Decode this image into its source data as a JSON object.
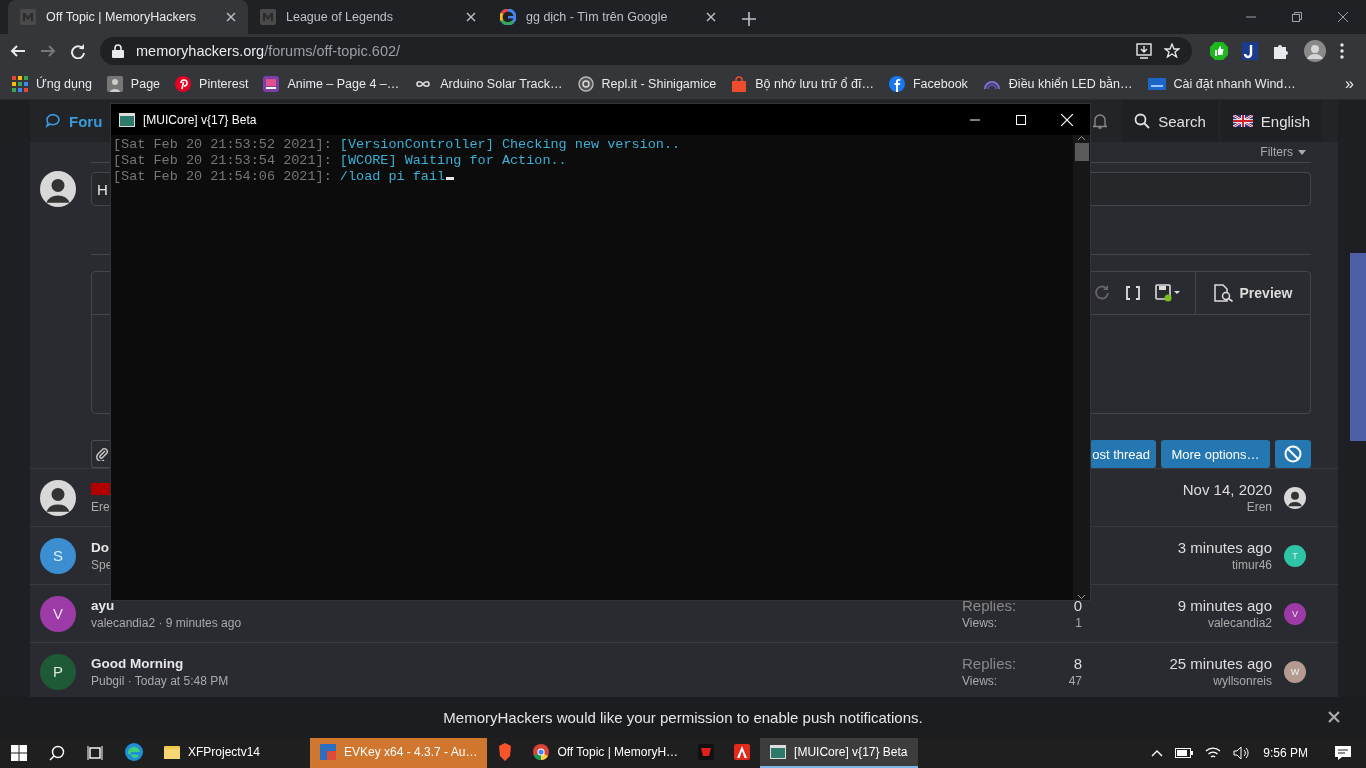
{
  "browser": {
    "tabs": [
      {
        "title": "Off Topic | MemoryHackers",
        "kind": "site",
        "selected": true
      },
      {
        "title": "League of Legends",
        "kind": "site",
        "selected": false
      },
      {
        "title": "gg dịch - Tìm trên Google",
        "kind": "google",
        "selected": false
      }
    ],
    "address": {
      "host": "memoryhackers.org",
      "path": "/forums/off-topic.602/"
    },
    "bookmarks": [
      {
        "label": "Ứng dụng",
        "kind": "apps"
      },
      {
        "label": "Page",
        "kind": "photo"
      },
      {
        "label": "Pinterest",
        "kind": "pinterest"
      },
      {
        "label": "Anime – Page 4 –…",
        "kind": "anime"
      },
      {
        "label": "Arduino Solar Track…",
        "kind": "infinity"
      },
      {
        "label": "Repl.it - Shinigamice",
        "kind": "swirl"
      },
      {
        "label": "Bộ nhớ lưu trữ ổ đĩ…",
        "kind": "bag"
      },
      {
        "label": "Facebook",
        "kind": "facebook"
      },
      {
        "label": "Điều khiển LED bằn…",
        "kind": "dome"
      },
      {
        "label": "Cài đặt nhanh Wind…",
        "kind": "vn"
      }
    ],
    "bookmarks_more": "»"
  },
  "forum": {
    "nav": {
      "title": "Foru",
      "search": "Search",
      "language": "English"
    },
    "filters": "Filters",
    "new_thread": {
      "value": "H"
    },
    "editor": {
      "preview": "Preview"
    },
    "buttons": {
      "post": "ost thread",
      "more": "More options…"
    },
    "threads": [
      {
        "prefix_tag": true,
        "meta": "Ere",
        "date": "Nov 14, 2020",
        "last_user": "Eren"
      },
      {
        "avatar": {
          "kind": "letter",
          "letter": "S",
          "color": "#3b8ed0"
        },
        "prefix_tag": false,
        "title": "Do",
        "meta": "Spe",
        "date": "3 minutes ago",
        "last_user": "timur46",
        "last_avatar": {
          "kind": "letter",
          "letter": "T",
          "color": "#2fc4a6"
        }
      },
      {
        "avatar": {
          "kind": "letter",
          "letter": "V",
          "color": "#9c3aa6"
        },
        "prefix_tag": false,
        "title": "ayu",
        "meta": "valecandia2 · 9 minutes ago",
        "replies_label": "Replies:",
        "replies": "0",
        "views_label": "Views:",
        "views": "1",
        "date": "9 minutes ago",
        "last_user": "valecandia2",
        "last_avatar": {
          "kind": "letter",
          "letter": "V",
          "color": "#9c3aa6"
        }
      },
      {
        "avatar": {
          "kind": "letter",
          "letter": "P",
          "color": "#1d5a35"
        },
        "prefix_tag": false,
        "title": "Good Morning",
        "meta": "Pubgil · Today at 5:48 PM",
        "replies_label": "Replies:",
        "replies": "8",
        "views_label": "Views:",
        "views": "47",
        "date": "25 minutes ago",
        "last_user": "wyllsonreis",
        "last_avatar": {
          "kind": "letter",
          "letter": "W",
          "color": "#b59a91"
        }
      }
    ]
  },
  "console": {
    "title": "[MUICore] v{17} Beta",
    "lines": [
      {
        "time": "[Sat Feb 20 21:53:52 2021]:",
        "text": "[VersionController] Checking new version.."
      },
      {
        "time": "[Sat Feb 20 21:53:54 2021]:",
        "text": "[WCORE] Waiting for Action.."
      },
      {
        "time": "[Sat Feb 20 21:54:06 2021]:",
        "text": "/load pi fail"
      }
    ]
  },
  "notification": {
    "text": "MemoryHackers would like your permission to enable push notifications."
  },
  "taskbar": {
    "apps": [
      {
        "kind": "edge",
        "selected": false,
        "attention": false
      },
      {
        "kind": "folder",
        "label": "XFProjectv14",
        "selected": false,
        "attention": false
      },
      {
        "kind": "evkey",
        "label": "EVKey x64 - 4.3.7 - Au…",
        "selected": false,
        "attention": true
      },
      {
        "kind": "brave",
        "selected": false,
        "attention": false
      },
      {
        "kind": "chrome",
        "label": "Off Topic | MemoryH…",
        "selected": false,
        "attention": false
      },
      {
        "kind": "redapp",
        "selected": false,
        "attention": false
      },
      {
        "kind": "acrobat",
        "selected": false,
        "attention": false
      },
      {
        "kind": "console",
        "label": "[MUICore] v{17} Beta",
        "selected": true,
        "attention": false
      }
    ],
    "time": "9:56 PM"
  }
}
